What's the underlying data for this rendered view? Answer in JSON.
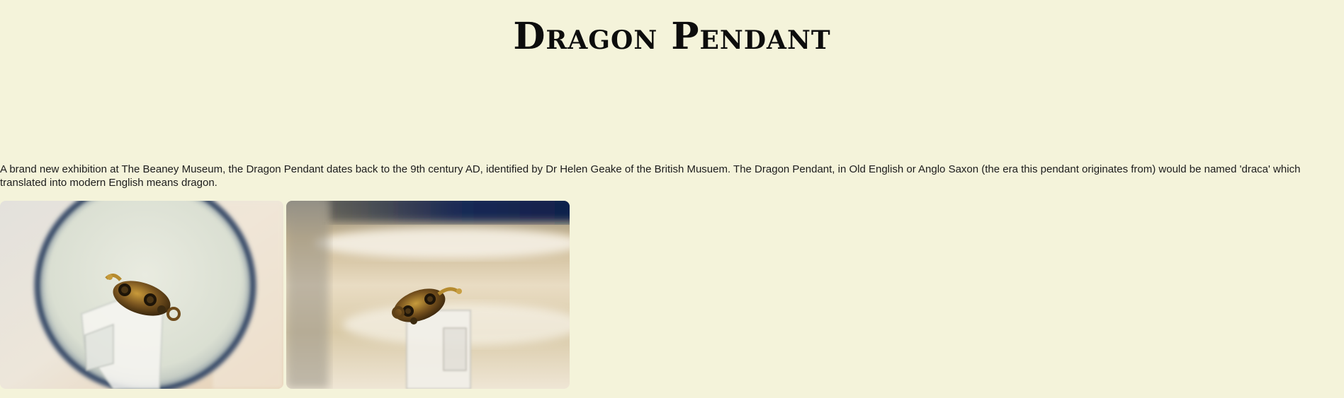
{
  "page": {
    "title": "Dragon Pendant",
    "intro": "A brand new exhibition at The Beaney Museum, the Dragon Pendant dates back to the 9th century AD, identified by Dr Helen Geake of the British Musuem. The Dragon Pendant, in Old English or Anglo Saxon (the era this pendant originates from) would be named 'draca' which translated into modern English means dragon."
  },
  "gallery": {
    "images": [
      {
        "subject": "dragon-pendant-under-magnifying-glass",
        "palette": [
          "#e6e3d6",
          "#d9cdb4",
          "#2c3a4c",
          "#6b4a1a",
          "#c29a3a"
        ]
      },
      {
        "subject": "dragon-pendant-on-acrylic-stand",
        "palette": [
          "#c8b89a",
          "#f2ece0",
          "#1b2b52",
          "#6b4a1a",
          "#c29a3a"
        ]
      }
    ]
  }
}
